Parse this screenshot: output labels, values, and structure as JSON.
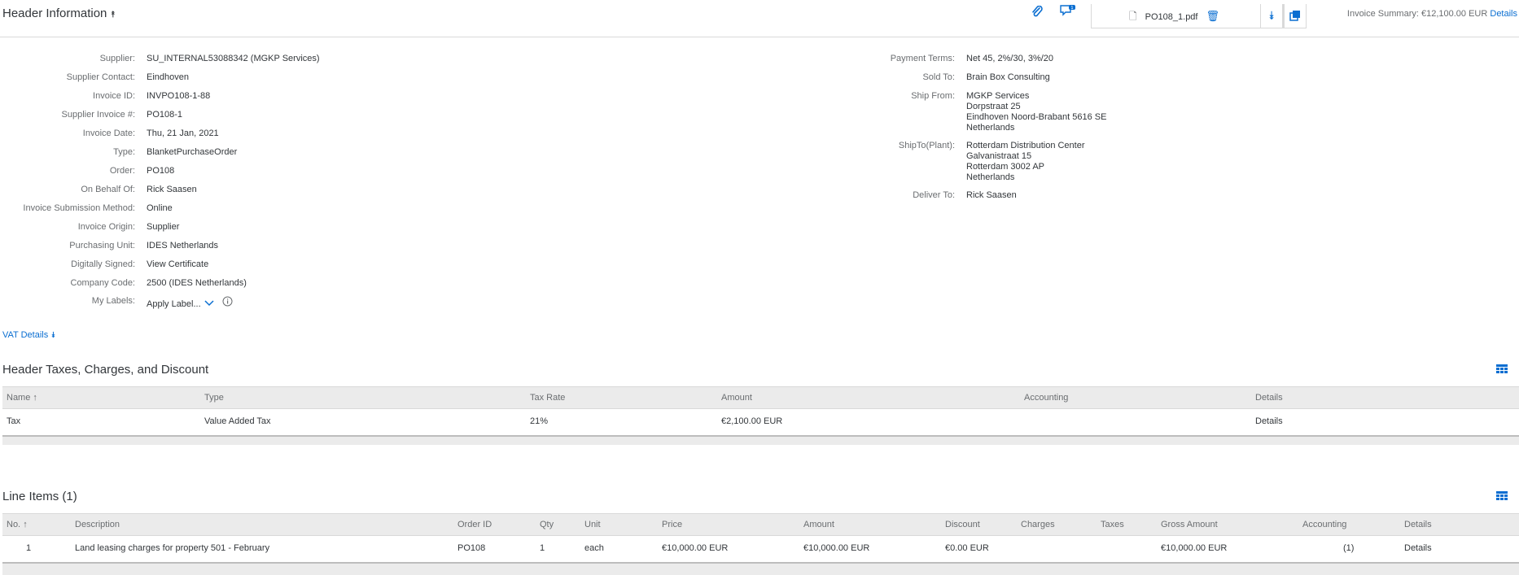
{
  "header": {
    "title": "Header Information",
    "attachment_file": "PO108_1.pdf",
    "invoice_summary_label": "Invoice Summary: €12,100.00 EUR",
    "details_link": "Details"
  },
  "left_fields": [
    {
      "label": "Supplier:",
      "value": "SU_INTERNAL53088342 (MGKP Services)",
      "link": true
    },
    {
      "label": "Supplier Contact:",
      "value": "Eindhoven",
      "link": true
    },
    {
      "label": "Invoice ID:",
      "value": "INVPO108-1-88",
      "link": false
    },
    {
      "label": "Supplier Invoice #:",
      "value": "PO108-1",
      "link": false
    },
    {
      "label": "Invoice Date:",
      "value": "Thu, 21 Jan, 2021",
      "link": false
    },
    {
      "label": "Type:",
      "value": "BlanketPurchaseOrder",
      "link": false
    },
    {
      "label": "Order:",
      "value": "PO108",
      "link": true
    },
    {
      "label": "On Behalf Of:",
      "value": "Rick Saasen",
      "link": true
    },
    {
      "label": "Invoice Submission Method:",
      "value": "Online",
      "link": false
    },
    {
      "label": "Invoice Origin:",
      "value": "Supplier",
      "link": false
    },
    {
      "label": "Purchasing Unit:",
      "value": "IDES Netherlands",
      "link": true
    },
    {
      "label": "Digitally Signed:",
      "value": "View Certificate",
      "link": true
    },
    {
      "label": "Company Code:",
      "value": "2500 (IDES Netherlands)",
      "link": true
    },
    {
      "label": "My Labels:",
      "value": "Apply Label...",
      "link": true
    }
  ],
  "right_fields": {
    "payment_terms_label": "Payment Terms:",
    "payment_terms_value": "Net 45, 2%/30, 3%/20",
    "sold_to_label": "Sold To:",
    "sold_to_value": "Brain Box Consulting",
    "ship_from_label": "Ship From:",
    "ship_from_lines": [
      "MGKP Services",
      "Dorpstraat 25",
      "Eindhoven Noord-Brabant 5616 SE",
      "Netherlands"
    ],
    "ship_to_label": "ShipTo(Plant):",
    "ship_to_lines": [
      "Rotterdam Distribution Center",
      "Galvanistraat 15",
      "Rotterdam  3002 AP",
      "Netherlands"
    ],
    "deliver_to_label": "Deliver To:",
    "deliver_to_value": "Rick Saasen"
  },
  "vat_details": "VAT Details",
  "taxes_section": {
    "title": "Header Taxes, Charges, and Discount",
    "columns": [
      "Name",
      "Type",
      "Tax Rate",
      "Amount",
      "Accounting",
      "Details"
    ],
    "row": {
      "name": "Tax",
      "type": "Value Added Tax",
      "rate": "21%",
      "amount": "€2,100.00 EUR",
      "accounting": "",
      "details": "Details"
    }
  },
  "line_items": {
    "title": "Line Items (1)",
    "columns": [
      "No.",
      "Description",
      "Order ID",
      "Qty",
      "Unit",
      "Price",
      "Amount",
      "Discount",
      "Charges",
      "Taxes",
      "Gross Amount",
      "Accounting",
      "Details"
    ],
    "row": {
      "no": "1",
      "description": "Land leasing charges for property 501 - February",
      "order_id": "PO108",
      "qty": "1",
      "unit": "each",
      "price": "€10,000.00 EUR",
      "amount": "€10,000.00 EUR",
      "discount": "€0.00 EUR",
      "charges": "",
      "taxes": "",
      "gross": "€10,000.00 EUR",
      "accounting": "(1)",
      "details": "Details"
    }
  },
  "icons": {
    "attach": "paperclip-icon",
    "comments": "comments-icon",
    "collapse": "double-chevron-up-icon",
    "table_settings": "table-settings-icon"
  }
}
